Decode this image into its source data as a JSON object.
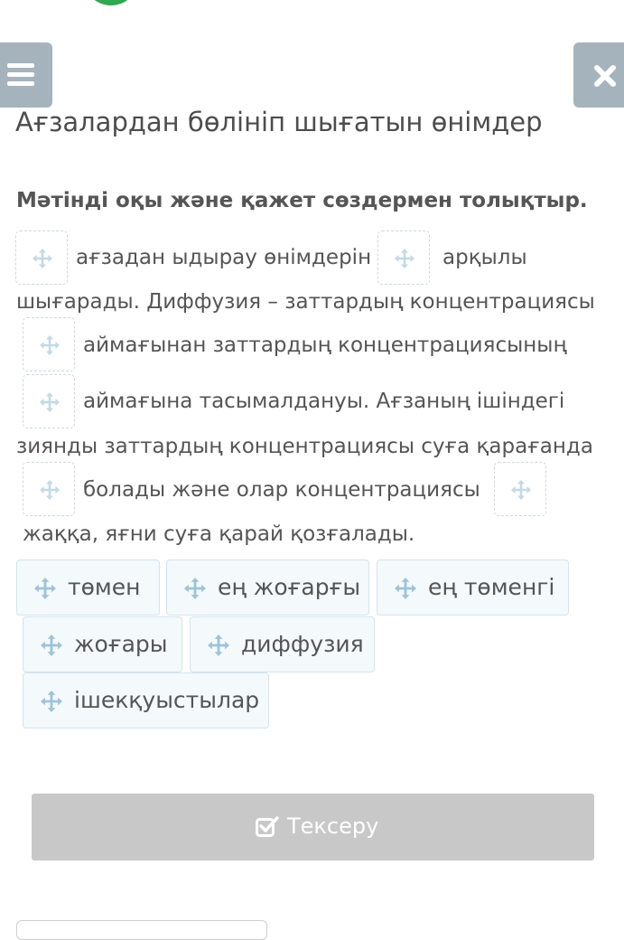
{
  "header": {
    "title": "Ағзалардан бөлініп шығатын өнімдер",
    "menu_icon": "hamburger-menu-icon",
    "close_icon": "close-x-icon",
    "logo_color": "#2fa84f"
  },
  "task": {
    "instruction": "Мәтінді оқы және қажет сөздермен толықтыр.",
    "text_segments": [
      "ағзадан ыдырау өнімдерін",
      "арқылы",
      "шығарады. Диффузия – заттардың концентрациясы",
      "аймағынан заттардың концентрациясының",
      "аймағына тасымалдануы. Ағзаның ішіндегі",
      "зиянды заттардың концентрациясы суға қарағанда",
      "болады және олар концентрациясы",
      "жаққа, яғни суға қарай қозғалады."
    ],
    "blank_count": 6,
    "blank_icon": "move-arrows-icon"
  },
  "options": [
    "төмен",
    "ең жоғарғы",
    "ең төменгі",
    "жоғары",
    "диффузия",
    "ішекқуыстылар"
  ],
  "actions": {
    "check_label": "Тексеру",
    "check_icon": "checkbox-check-icon",
    "check_disabled": true
  },
  "colors": {
    "header_button_bg": "#a5b3bd",
    "chip_bg": "#f4f9fc",
    "chip_border": "#d4e4ee",
    "check_button_bg": "#c8c8c8"
  }
}
